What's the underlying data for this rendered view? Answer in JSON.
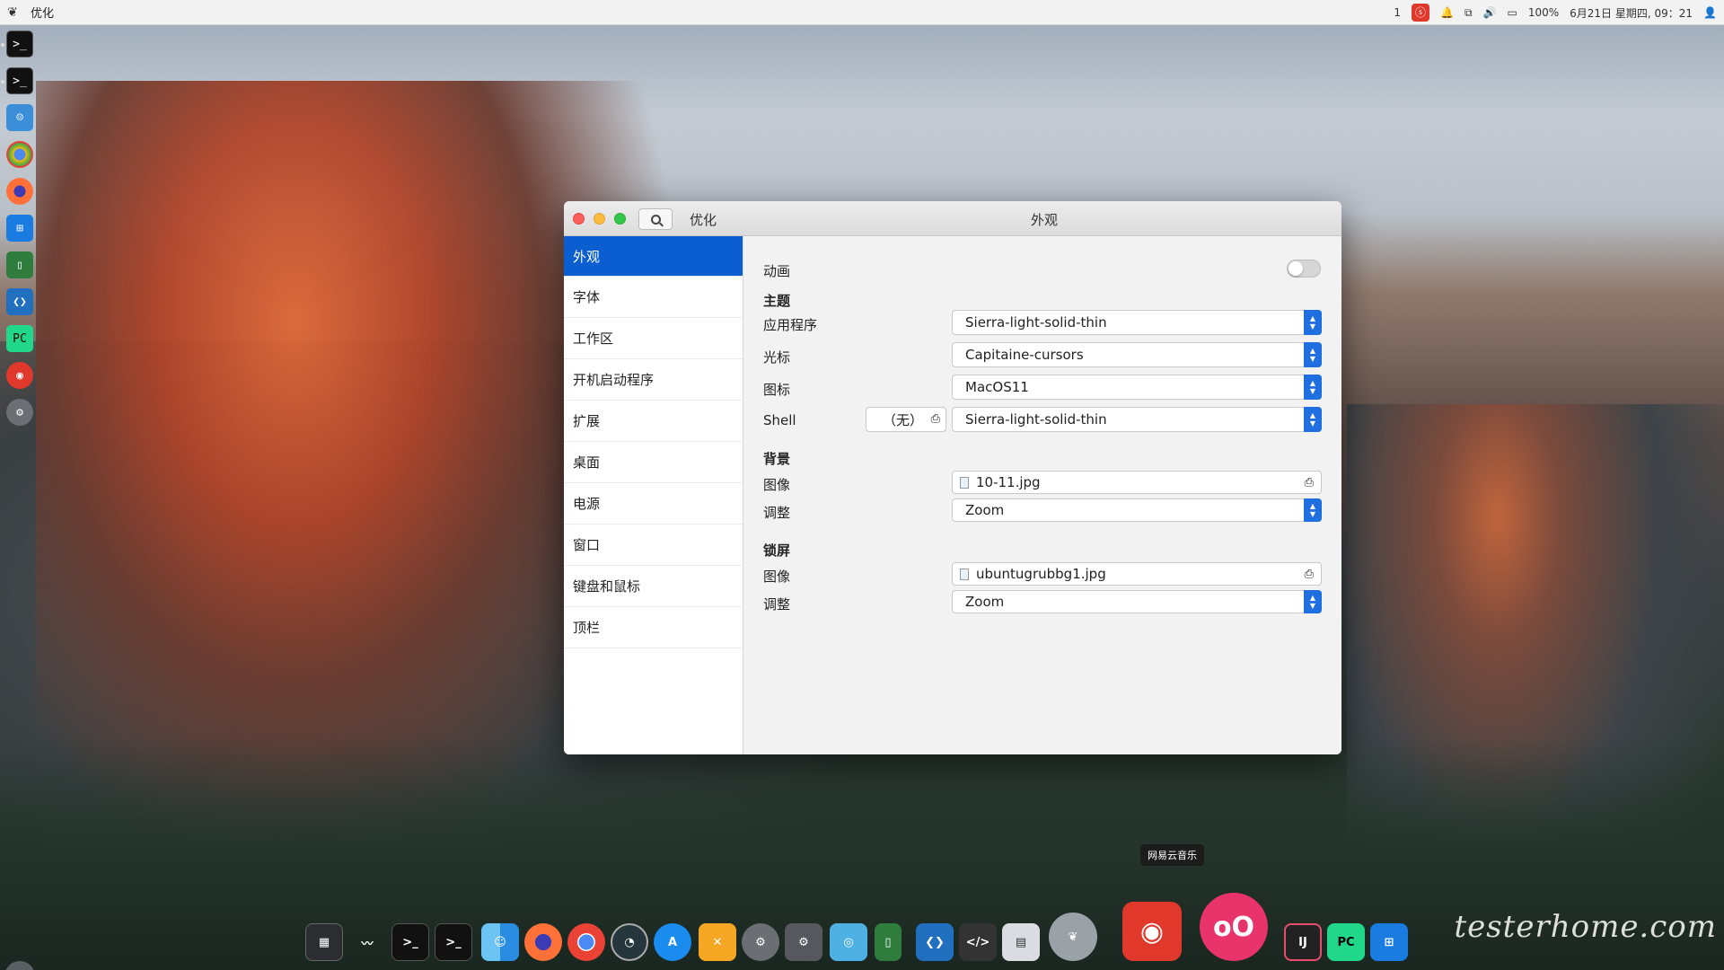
{
  "topbar": {
    "app_name": "优化",
    "workspace": "1",
    "netease_glyph": "ⓢ",
    "battery": "100%",
    "datetime": "6月21日 星期四, 09：21"
  },
  "window": {
    "search_label": "search",
    "left_title": "优化",
    "center_title": "外观"
  },
  "sidebar": {
    "items": [
      {
        "label": "外观"
      },
      {
        "label": "字体"
      },
      {
        "label": "工作区"
      },
      {
        "label": "开机启动程序"
      },
      {
        "label": "扩展"
      },
      {
        "label": "桌面"
      },
      {
        "label": "电源"
      },
      {
        "label": "窗口"
      },
      {
        "label": "键盘和鼠标"
      },
      {
        "label": "顶栏"
      }
    ]
  },
  "content": {
    "animation_label": "动画",
    "animation_on": false,
    "theme_heading": "主题",
    "app_label": "应用程序",
    "app_value": "Sierra-light-solid-thin",
    "cursor_label": "光标",
    "cursor_value": "Capitaine-cursors",
    "icon_label": "图标",
    "icon_value": "MacOS11",
    "shell_label": "Shell",
    "shell_none": "（无）",
    "shell_value": "Sierra-light-solid-thin",
    "bg_heading": "背景",
    "bg_image_label": "图像",
    "bg_image_value": "10-11.jpg",
    "bg_adjust_label": "调整",
    "bg_adjust_value": "Zoom",
    "lock_heading": "锁屏",
    "lock_image_label": "图像",
    "lock_image_value": "ubuntugrubbg1.jpg",
    "lock_adjust_label": "调整",
    "lock_adjust_value": "Zoom"
  },
  "dock": {
    "tooltip": "网易云音乐",
    "pycharm": "PC",
    "intellij": "IJ"
  },
  "watermark": "testerhome.com",
  "colors": {
    "accent": "#0b5ed0",
    "combo_arrow": "#1f6fe0",
    "netease_red": "#e0392b"
  }
}
